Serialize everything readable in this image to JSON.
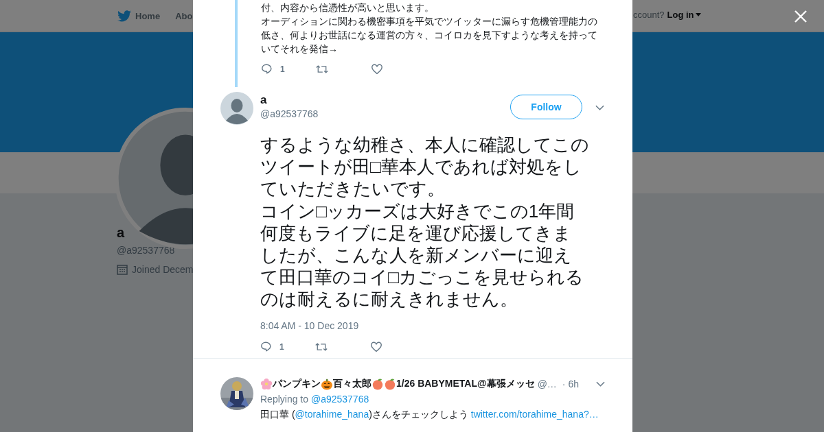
{
  "nav": {
    "items": [
      {
        "label": "Home",
        "kind": "home"
      },
      {
        "label": "Abo",
        "kind": "link"
      }
    ],
    "account_prompt": "ccount?",
    "login": "Log in"
  },
  "profile": {
    "name": "a",
    "handle": "@a92537768",
    "joined": "Joined Decem"
  },
  "previous_tweet": {
    "lines": [
      "付、内容から信憑性が高いと思います。",
      "オーディションに関わる機密事項を平気でツイッターに漏らす危機管理能力の",
      "低さ、何よりお世話になる運営の方々、コイロカを見下すような考えを持って",
      "いてそれを発信→"
    ],
    "replies": "1"
  },
  "tweet": {
    "name": "a",
    "handle": "@a92537768",
    "follow": "Follow",
    "lines": [
      "するような幼稚さ、本人に確認してこの",
      "ツイートが田□華本人であれば対処をし",
      "ていただきたいです。",
      "コイン□ッカーズは大好きでこの1年間",
      "何度もライブに足を運び応援してきま",
      "したが、こんな人を新メンバーに迎え",
      "て田口華のコイ□カごっこを見せられる",
      "のは耐えるに耐えきれません。"
    ],
    "timestamp": "8:04 AM - 10 Dec 2019",
    "replies": "1"
  },
  "reply": {
    "name_parts": [
      {
        "kind": "flower"
      },
      {
        "kind": "text",
        "text": "パンプキン"
      },
      {
        "kind": "pumpkin"
      },
      {
        "kind": "text",
        "text": "百々太郎"
      },
      {
        "kind": "peach"
      },
      {
        "kind": "peach"
      },
      {
        "kind": "text",
        "text": "1/26 BABYMETAL@幕張メッセ"
      }
    ],
    "handle": "@…",
    "time": "· 6h",
    "replying_label": "Replying to",
    "replying_to": "@a92537768",
    "text_parts": [
      {
        "kind": "text",
        "text": "田口華 ("
      },
      {
        "kind": "link",
        "text": "@torahime_hana"
      },
      {
        "kind": "text",
        "text": ")さんをチェックしよう "
      },
      {
        "kind": "link",
        "text": "twitter.com/torahime_hana?…"
      }
    ]
  }
}
